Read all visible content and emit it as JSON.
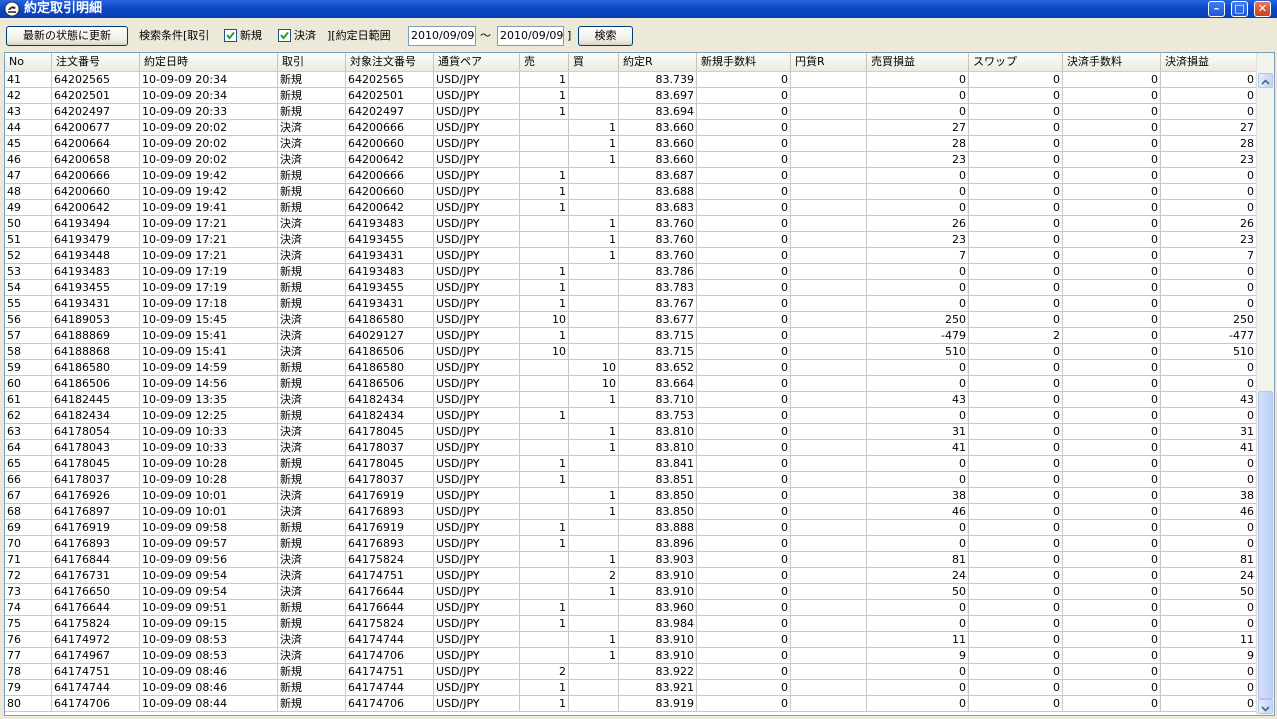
{
  "window": {
    "title": "約定取引明細",
    "minimize_glyph": "–",
    "maximize_glyph": "□",
    "close_glyph": "✕"
  },
  "toolbar": {
    "refresh_label": "最新の状態に更新",
    "search_cond_label": "検索条件[取引",
    "new_label": "新規",
    "settle_label": "決済",
    "date_range_label": "][約定日範囲",
    "date_from": "2010/09/09",
    "tilde": "～",
    "date_to": "2010/09/09",
    "bracket_close": "]",
    "search_label": "検索",
    "new_checked": true,
    "settle_checked": true
  },
  "table": {
    "columns": [
      "No",
      "注文番号",
      "約定日時",
      "取引",
      "対象注文番号",
      "通貨ペア",
      "売",
      "買",
      "約定R",
      "新規手数料",
      "円貨R",
      "売買損益",
      "スワップ",
      "決済手数料",
      "決済損益"
    ],
    "rows": [
      [
        "41",
        "64202565",
        "10-09-09 20:34",
        "新規",
        "64202565",
        "USD/JPY",
        "1",
        "",
        "83.739",
        "0",
        "",
        "0",
        "0",
        "0",
        "0"
      ],
      [
        "42",
        "64202501",
        "10-09-09 20:34",
        "新規",
        "64202501",
        "USD/JPY",
        "1",
        "",
        "83.697",
        "0",
        "",
        "0",
        "0",
        "0",
        "0"
      ],
      [
        "43",
        "64202497",
        "10-09-09 20:33",
        "新規",
        "64202497",
        "USD/JPY",
        "1",
        "",
        "83.694",
        "0",
        "",
        "0",
        "0",
        "0",
        "0"
      ],
      [
        "44",
        "64200677",
        "10-09-09 20:02",
        "決済",
        "64200666",
        "USD/JPY",
        "",
        "1",
        "83.660",
        "0",
        "",
        "27",
        "0",
        "0",
        "27"
      ],
      [
        "45",
        "64200664",
        "10-09-09 20:02",
        "決済",
        "64200660",
        "USD/JPY",
        "",
        "1",
        "83.660",
        "0",
        "",
        "28",
        "0",
        "0",
        "28"
      ],
      [
        "46",
        "64200658",
        "10-09-09 20:02",
        "決済",
        "64200642",
        "USD/JPY",
        "",
        "1",
        "83.660",
        "0",
        "",
        "23",
        "0",
        "0",
        "23"
      ],
      [
        "47",
        "64200666",
        "10-09-09 19:42",
        "新規",
        "64200666",
        "USD/JPY",
        "1",
        "",
        "83.687",
        "0",
        "",
        "0",
        "0",
        "0",
        "0"
      ],
      [
        "48",
        "64200660",
        "10-09-09 19:42",
        "新規",
        "64200660",
        "USD/JPY",
        "1",
        "",
        "83.688",
        "0",
        "",
        "0",
        "0",
        "0",
        "0"
      ],
      [
        "49",
        "64200642",
        "10-09-09 19:41",
        "新規",
        "64200642",
        "USD/JPY",
        "1",
        "",
        "83.683",
        "0",
        "",
        "0",
        "0",
        "0",
        "0"
      ],
      [
        "50",
        "64193494",
        "10-09-09 17:21",
        "決済",
        "64193483",
        "USD/JPY",
        "",
        "1",
        "83.760",
        "0",
        "",
        "26",
        "0",
        "0",
        "26"
      ],
      [
        "51",
        "64193479",
        "10-09-09 17:21",
        "決済",
        "64193455",
        "USD/JPY",
        "",
        "1",
        "83.760",
        "0",
        "",
        "23",
        "0",
        "0",
        "23"
      ],
      [
        "52",
        "64193448",
        "10-09-09 17:21",
        "決済",
        "64193431",
        "USD/JPY",
        "",
        "1",
        "83.760",
        "0",
        "",
        "7",
        "0",
        "0",
        "7"
      ],
      [
        "53",
        "64193483",
        "10-09-09 17:19",
        "新規",
        "64193483",
        "USD/JPY",
        "1",
        "",
        "83.786",
        "0",
        "",
        "0",
        "0",
        "0",
        "0"
      ],
      [
        "54",
        "64193455",
        "10-09-09 17:19",
        "新規",
        "64193455",
        "USD/JPY",
        "1",
        "",
        "83.783",
        "0",
        "",
        "0",
        "0",
        "0",
        "0"
      ],
      [
        "55",
        "64193431",
        "10-09-09 17:18",
        "新規",
        "64193431",
        "USD/JPY",
        "1",
        "",
        "83.767",
        "0",
        "",
        "0",
        "0",
        "0",
        "0"
      ],
      [
        "56",
        "64189053",
        "10-09-09 15:45",
        "決済",
        "64186580",
        "USD/JPY",
        "10",
        "",
        "83.677",
        "0",
        "",
        "250",
        "0",
        "0",
        "250"
      ],
      [
        "57",
        "64188869",
        "10-09-09 15:41",
        "決済",
        "64029127",
        "USD/JPY",
        "1",
        "",
        "83.715",
        "0",
        "",
        "-479",
        "2",
        "0",
        "-477"
      ],
      [
        "58",
        "64188868",
        "10-09-09 15:41",
        "決済",
        "64186506",
        "USD/JPY",
        "10",
        "",
        "83.715",
        "0",
        "",
        "510",
        "0",
        "0",
        "510"
      ],
      [
        "59",
        "64186580",
        "10-09-09 14:59",
        "新規",
        "64186580",
        "USD/JPY",
        "",
        "10",
        "83.652",
        "0",
        "",
        "0",
        "0",
        "0",
        "0"
      ],
      [
        "60",
        "64186506",
        "10-09-09 14:56",
        "新規",
        "64186506",
        "USD/JPY",
        "",
        "10",
        "83.664",
        "0",
        "",
        "0",
        "0",
        "0",
        "0"
      ],
      [
        "61",
        "64182445",
        "10-09-09 13:35",
        "決済",
        "64182434",
        "USD/JPY",
        "",
        "1",
        "83.710",
        "0",
        "",
        "43",
        "0",
        "0",
        "43"
      ],
      [
        "62",
        "64182434",
        "10-09-09 12:25",
        "新規",
        "64182434",
        "USD/JPY",
        "1",
        "",
        "83.753",
        "0",
        "",
        "0",
        "0",
        "0",
        "0"
      ],
      [
        "63",
        "64178054",
        "10-09-09 10:33",
        "決済",
        "64178045",
        "USD/JPY",
        "",
        "1",
        "83.810",
        "0",
        "",
        "31",
        "0",
        "0",
        "31"
      ],
      [
        "64",
        "64178043",
        "10-09-09 10:33",
        "決済",
        "64178037",
        "USD/JPY",
        "",
        "1",
        "83.810",
        "0",
        "",
        "41",
        "0",
        "0",
        "41"
      ],
      [
        "65",
        "64178045",
        "10-09-09 10:28",
        "新規",
        "64178045",
        "USD/JPY",
        "1",
        "",
        "83.841",
        "0",
        "",
        "0",
        "0",
        "0",
        "0"
      ],
      [
        "66",
        "64178037",
        "10-09-09 10:28",
        "新規",
        "64178037",
        "USD/JPY",
        "1",
        "",
        "83.851",
        "0",
        "",
        "0",
        "0",
        "0",
        "0"
      ],
      [
        "67",
        "64176926",
        "10-09-09 10:01",
        "決済",
        "64176919",
        "USD/JPY",
        "",
        "1",
        "83.850",
        "0",
        "",
        "38",
        "0",
        "0",
        "38"
      ],
      [
        "68",
        "64176897",
        "10-09-09 10:01",
        "決済",
        "64176893",
        "USD/JPY",
        "",
        "1",
        "83.850",
        "0",
        "",
        "46",
        "0",
        "0",
        "46"
      ],
      [
        "69",
        "64176919",
        "10-09-09 09:58",
        "新規",
        "64176919",
        "USD/JPY",
        "1",
        "",
        "83.888",
        "0",
        "",
        "0",
        "0",
        "0",
        "0"
      ],
      [
        "70",
        "64176893",
        "10-09-09 09:57",
        "新規",
        "64176893",
        "USD/JPY",
        "1",
        "",
        "83.896",
        "0",
        "",
        "0",
        "0",
        "0",
        "0"
      ],
      [
        "71",
        "64176844",
        "10-09-09 09:56",
        "決済",
        "64175824",
        "USD/JPY",
        "",
        "1",
        "83.903",
        "0",
        "",
        "81",
        "0",
        "0",
        "81"
      ],
      [
        "72",
        "64176731",
        "10-09-09 09:54",
        "決済",
        "64174751",
        "USD/JPY",
        "",
        "2",
        "83.910",
        "0",
        "",
        "24",
        "0",
        "0",
        "24"
      ],
      [
        "73",
        "64176650",
        "10-09-09 09:54",
        "決済",
        "64176644",
        "USD/JPY",
        "",
        "1",
        "83.910",
        "0",
        "",
        "50",
        "0",
        "0",
        "50"
      ],
      [
        "74",
        "64176644",
        "10-09-09 09:51",
        "新規",
        "64176644",
        "USD/JPY",
        "1",
        "",
        "83.960",
        "0",
        "",
        "0",
        "0",
        "0",
        "0"
      ],
      [
        "75",
        "64175824",
        "10-09-09 09:15",
        "新規",
        "64175824",
        "USD/JPY",
        "1",
        "",
        "83.984",
        "0",
        "",
        "0",
        "0",
        "0",
        "0"
      ],
      [
        "76",
        "64174972",
        "10-09-09 08:53",
        "決済",
        "64174744",
        "USD/JPY",
        "",
        "1",
        "83.910",
        "0",
        "",
        "11",
        "0",
        "0",
        "11"
      ],
      [
        "77",
        "64174967",
        "10-09-09 08:53",
        "決済",
        "64174706",
        "USD/JPY",
        "",
        "1",
        "83.910",
        "0",
        "",
        "9",
        "0",
        "0",
        "9"
      ],
      [
        "78",
        "64174751",
        "10-09-09 08:46",
        "新規",
        "64174751",
        "USD/JPY",
        "2",
        "",
        "83.922",
        "0",
        "",
        "0",
        "0",
        "0",
        "0"
      ],
      [
        "79",
        "64174744",
        "10-09-09 08:46",
        "新規",
        "64174744",
        "USD/JPY",
        "1",
        "",
        "83.921",
        "0",
        "",
        "0",
        "0",
        "0",
        "0"
      ],
      [
        "80",
        "64174706",
        "10-09-09 08:44",
        "新規",
        "64174706",
        "USD/JPY",
        "1",
        "",
        "83.919",
        "0",
        "",
        "0",
        "0",
        "0",
        "0"
      ]
    ]
  },
  "scrollbar": {
    "up_glyph": "▲",
    "down_glyph": "▼"
  }
}
